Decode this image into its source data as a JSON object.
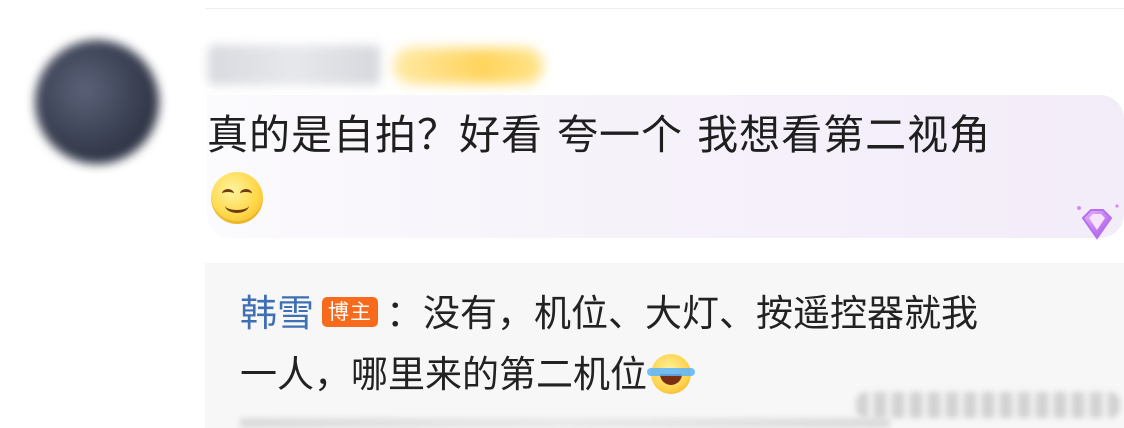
{
  "comment": {
    "text": "真的是自拍？好看 夸一个 我想看第二视角",
    "emoji": "smile-emoji"
  },
  "reply": {
    "author": "韩雪",
    "author_badge": "博主",
    "line1": "：没有，机位、大灯、按遥控器就我",
    "line2": "一人，哪里来的第二机位",
    "emoji": "laugh-cry-emoji"
  },
  "colors": {
    "author_link": "#3f6fb5",
    "host_badge": "#f86b1c"
  },
  "icons": {
    "member_gem": "purple-gem-icon"
  }
}
